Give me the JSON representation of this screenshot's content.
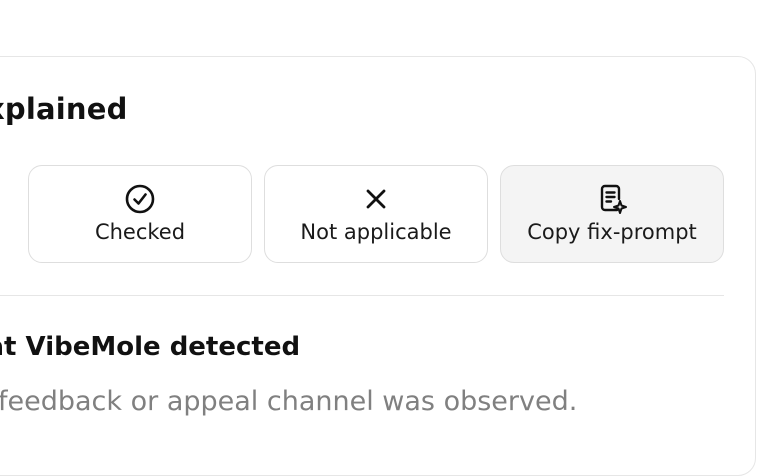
{
  "panel": {
    "heading": "xplained"
  },
  "actions": {
    "checked": {
      "label": "Checked",
      "icon": "check-circle-icon"
    },
    "not_applicable": {
      "label": "Not applicable",
      "icon": "close-x-icon"
    },
    "copy_fix_prompt": {
      "label": "Copy fix-prompt",
      "icon": "copy-document-sparkle-icon"
    }
  },
  "detection": {
    "title": "hat VibeMole detected",
    "body": "feedback or appeal channel was observed."
  }
}
